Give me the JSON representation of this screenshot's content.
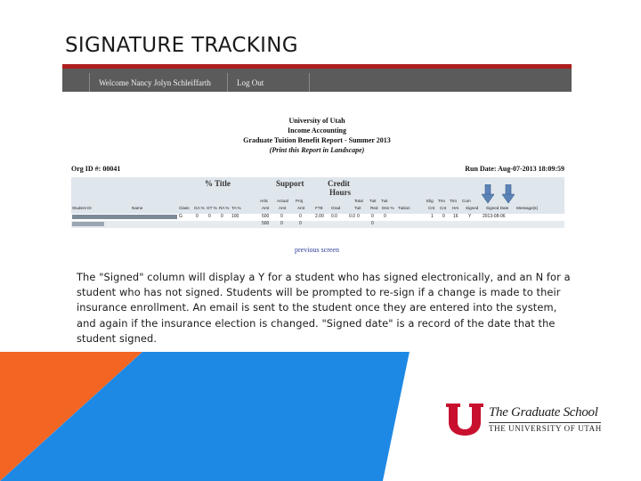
{
  "slide": {
    "title": "SIGNATURE TRACKING",
    "body": "The \"Signed\" column will display a Y for a student who has signed electronically, and an N for a student who has not signed. Students will be prompted to re-sign if a change is made to their insurance enrollment. An email is sent to the student once they are entered into the system, and again if the insurance election is changed. \"Signed date\" is a record of the date that the student signed."
  },
  "app": {
    "welcome": "Welcome Nancy Jolyn Schleiffarth",
    "logout": "Log Out",
    "accent": "#b01e1e"
  },
  "report": {
    "university": "University of Utah",
    "dept": "Income Accounting",
    "title": "Graduate Tuition Benefit Report - Summer 2013",
    "note": "(Print this Report in Landscape)",
    "org": "Org ID #: 00041",
    "run": "Run Date: Aug-07-2013 18:09:59",
    "groups": [
      "% Title",
      "Support",
      "Credit",
      "Hours"
    ],
    "columns_top": [
      "Artic",
      "Actual",
      "Proj",
      "Total",
      "Tuit",
      "Tuit",
      "Elig",
      "Trm",
      "Trm",
      "Cum"
    ],
    "columns": [
      "Student ID",
      "Name",
      "Class",
      "GA %",
      "GT %",
      "RA %",
      "TA %",
      "Amt",
      "Amt",
      "Amt",
      "FTE",
      "Grad",
      "Tuit",
      "Red",
      "Dsn %",
      "Tuition",
      "Cnt",
      "Cnt",
      "Hrs",
      "Signed",
      "Signed Date",
      "Message(s)"
    ],
    "row1": [
      "G",
      "0",
      "0",
      "0",
      "100",
      "500",
      "0",
      "0",
      "2.00",
      "0.0",
      "0.0",
      "0",
      "0",
      "0",
      "1",
      "0",
      "16",
      "Y",
      "2013-08-06"
    ],
    "row2": [
      "500",
      "0",
      "0",
      "0"
    ],
    "previous": "previous screen"
  },
  "logo": {
    "name": "The Graduate School",
    "sub": "THE UNIVERSITY OF UTAH"
  },
  "colors": {
    "utah_red": "#c8102e",
    "orange": "#f26522",
    "blue": "#1e88e5"
  }
}
